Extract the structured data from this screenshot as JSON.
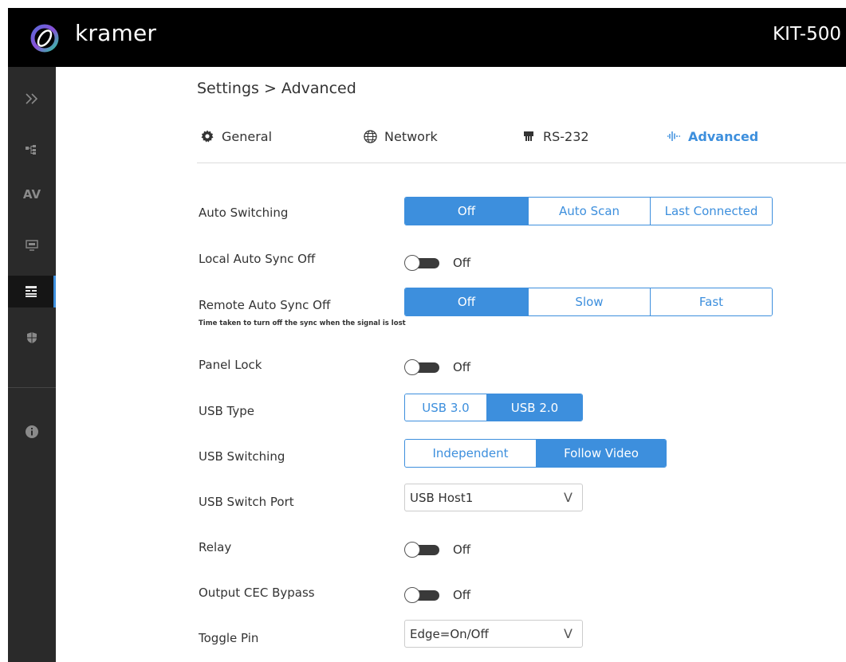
{
  "header": {
    "brand": "kramer",
    "model": "KIT-500"
  },
  "sidebar": {
    "items": [
      {
        "name": "expand",
        "icon": "double-chevron-right-icon"
      },
      {
        "name": "routing",
        "icon": "routing-icon"
      },
      {
        "name": "av",
        "label": "AV"
      },
      {
        "name": "display",
        "icon": "display-icon"
      },
      {
        "name": "settings",
        "icon": "settings-panel-icon",
        "active": true
      },
      {
        "name": "security",
        "icon": "shield-icon"
      },
      {
        "name": "info",
        "icon": "info-icon"
      }
    ]
  },
  "breadcrumb": "Settings > Advanced",
  "tabs": [
    {
      "label": "General",
      "icon": "gear-icon"
    },
    {
      "label": "Network",
      "icon": "globe-icon"
    },
    {
      "label": "RS-232",
      "icon": "serial-port-icon"
    },
    {
      "label": "Advanced",
      "icon": "advanced-bars-icon",
      "active": true
    }
  ],
  "settings": {
    "auto_switching": {
      "label": "Auto Switching",
      "options": [
        "Off",
        "Auto Scan",
        "Last Connected"
      ],
      "selected": "Off"
    },
    "local_auto_sync_off": {
      "label": "Local Auto Sync Off",
      "state": "Off"
    },
    "remote_auto_sync_off": {
      "label": "Remote Auto Sync Off",
      "hint": "Time taken to turn off the sync when the signal is lost",
      "options": [
        "Off",
        "Slow",
        "Fast"
      ],
      "selected": "Off"
    },
    "panel_lock": {
      "label": "Panel Lock",
      "state": "Off"
    },
    "usb_type": {
      "label": "USB Type",
      "options": [
        "USB 3.0",
        "USB 2.0"
      ],
      "selected": "USB 2.0"
    },
    "usb_switching": {
      "label": "USB Switching",
      "options": [
        "Independent",
        "Follow Video"
      ],
      "selected": "Follow Video"
    },
    "usb_switch_port": {
      "label": "USB Switch Port",
      "value": "USB Host1",
      "chevron": "V"
    },
    "relay": {
      "label": "Relay",
      "state": "Off"
    },
    "output_cec_bypass": {
      "label": "Output CEC Bypass",
      "state": "Off"
    },
    "toggle_pin": {
      "label": "Toggle Pin",
      "value": "Edge=On/Off",
      "chevron": "V"
    }
  },
  "colors": {
    "accent": "#3d8fdd",
    "sidebar": "#2a2a2a",
    "topbar": "#000000"
  }
}
